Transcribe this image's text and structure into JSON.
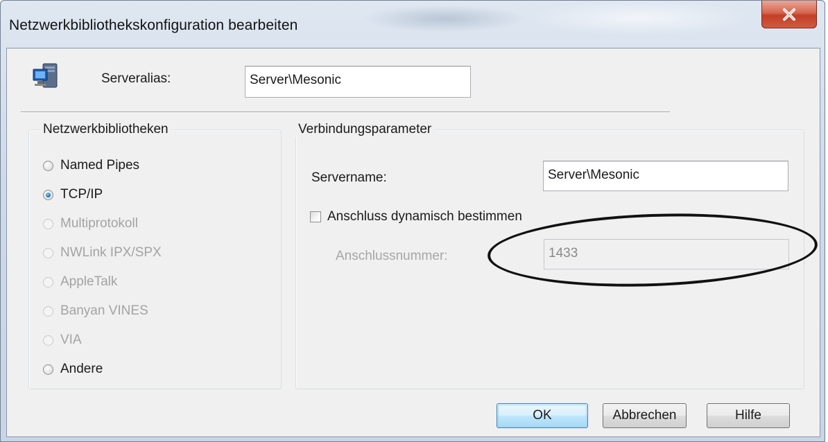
{
  "window": {
    "title": "Netzwerkbibliothekskonfiguration bearbeiten",
    "close_icon": "close-x-icon",
    "accent_close": "#c94a2f"
  },
  "alias": {
    "icon": "server-computer-icon",
    "label": "Serveralias:",
    "value": "Server\\Mesonic"
  },
  "libraries": {
    "title": "Netzwerkbibliotheken",
    "options": [
      {
        "label": "Named Pipes",
        "checked": false,
        "enabled": true
      },
      {
        "label": "TCP/IP",
        "checked": true,
        "enabled": true
      },
      {
        "label": "Multiprotokoll",
        "checked": false,
        "enabled": false
      },
      {
        "label": "NWLink IPX/SPX",
        "checked": false,
        "enabled": false
      },
      {
        "label": "AppleTalk",
        "checked": false,
        "enabled": false
      },
      {
        "label": "Banyan VINES",
        "checked": false,
        "enabled": false
      },
      {
        "label": "VIA",
        "checked": false,
        "enabled": false
      },
      {
        "label": "Andere",
        "checked": false,
        "enabled": true
      }
    ]
  },
  "connection": {
    "title": "Verbindungsparameter",
    "server_label": "Servername:",
    "server_value": "Server\\Mesonic",
    "dynamic_port_label": "Anschluss dynamisch bestimmen",
    "dynamic_port_checked": false,
    "port_label": "Anschlussnummer:",
    "port_value": "1433"
  },
  "buttons": {
    "ok": "OK",
    "cancel": "Abbrechen",
    "help": "Hilfe"
  }
}
